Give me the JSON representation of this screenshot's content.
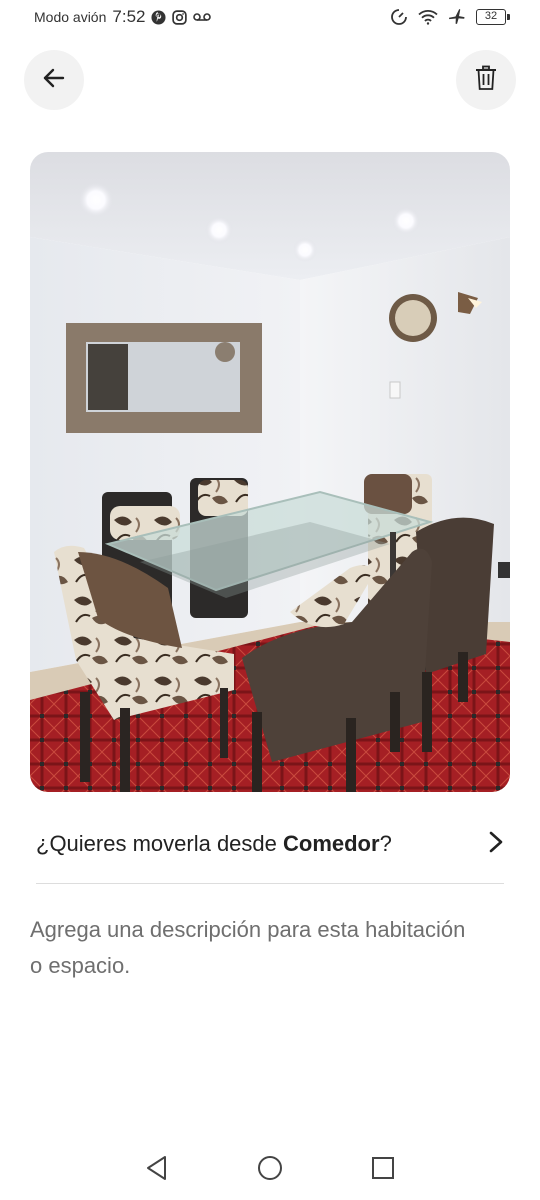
{
  "status_bar": {
    "mode": "Modo avión",
    "time": "7:52",
    "battery": "32",
    "icons": [
      "pinterest-icon",
      "instagram-icon",
      "voicemail-icon",
      "data-saver-icon",
      "wifi-icon",
      "airplane-icon",
      "battery-icon"
    ]
  },
  "header": {
    "back_icon": "arrow-left-icon",
    "delete_icon": "trash-icon"
  },
  "photo": {
    "subject": "dining-room"
  },
  "move_prompt": {
    "prefix": "¿Quieres moverla desde ",
    "room": "Comedor",
    "suffix": "?",
    "chevron_icon": "chevron-right-icon"
  },
  "description": {
    "placeholder": "Agrega una descripción para esta habitación o espacio."
  },
  "nav": {
    "icons": [
      "back-triangle-icon",
      "home-circle-icon",
      "recents-square-icon"
    ]
  },
  "colors": {
    "background": "#ffffff",
    "circle_button": "#f2f2f2",
    "text": "#222222",
    "placeholder": "#6f6f6f",
    "divider": "#dddddd"
  }
}
